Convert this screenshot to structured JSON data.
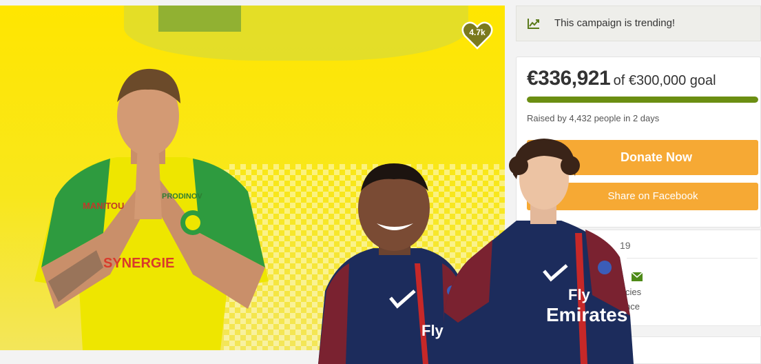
{
  "hero": {
    "heart_count": "4.7k",
    "jersey_sponsor_left": "MANITOU",
    "jersey_sponsor_right": "PRODINOV",
    "jersey_front_text": "SYNERGIE"
  },
  "trending": {
    "icon": "trend-chart-icon",
    "text": "This campaign is trending!"
  },
  "fundraising": {
    "amount": "€336,921",
    "goal_text": "of €300,000 goal",
    "progress_fraction": 1.0,
    "raised_by": "Raised by 4,432 people in 2 days",
    "donate_label": "Donate Now",
    "share_label": "Share on Facebook"
  },
  "info": {
    "partial_line1": "19",
    "partial_line2": "cies",
    "partial_line3": "nce",
    "mail_icon": "envelope-icon"
  },
  "overlays": {
    "jersey_text_mid": "Fly Emirate",
    "jersey_text_right_line1": "Fly",
    "jersey_text_right_line2": "Emirates"
  },
  "colors": {
    "accent_orange": "#f6a934",
    "progress_green": "#6b8e12",
    "heart_olive": "#7b7a1e"
  }
}
